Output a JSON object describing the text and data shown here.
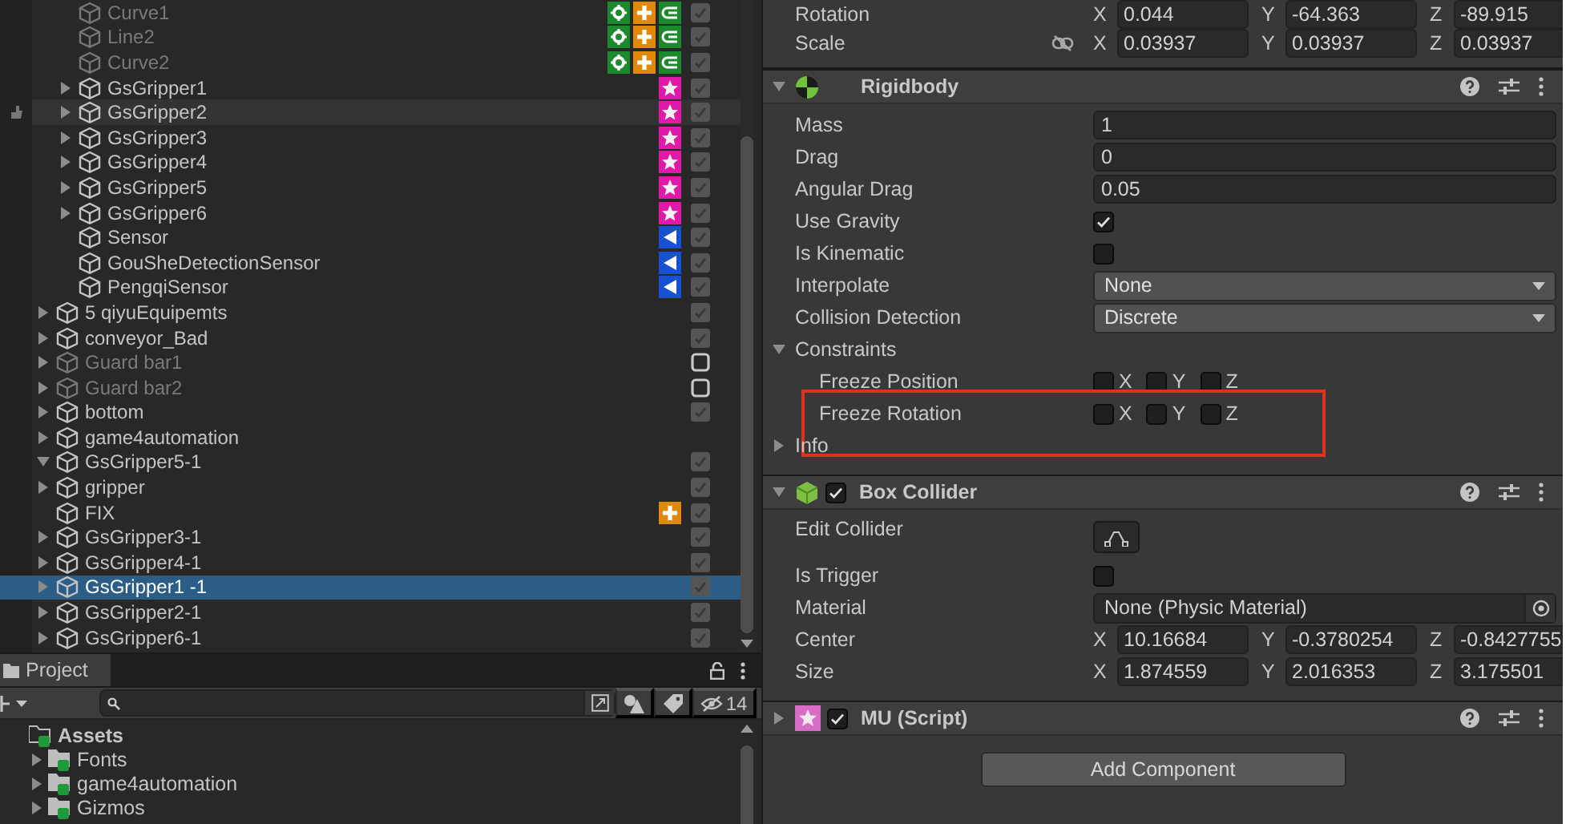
{
  "hierarchy": {
    "items": [
      {
        "children": [
          {
            "children": [
              {
                "children": [
                  {
                    "label": "Curve1",
                    "dimmed": true,
                    "selected": false,
                    "hovered": false,
                    "checked": true,
                    "badges": [
                      {
                        "kind": "gear"
                      },
                      {
                        "kind": "plus"
                      },
                      {
                        "kind": "curve"
                      }
                    ]
                  },
                  {
                    "label": "Line2",
                    "dimmed": true,
                    "selected": false,
                    "hovered": false,
                    "checked": true,
                    "badges": [
                      {
                        "kind": "gear"
                      },
                      {
                        "kind": "plus"
                      },
                      {
                        "kind": "curve"
                      }
                    ]
                  },
                  {
                    "label": "Curve2",
                    "dimmed": true,
                    "selected": false,
                    "hovered": false,
                    "checked": true,
                    "badges": [
                      {
                        "kind": "gear"
                      },
                      {
                        "kind": "plus"
                      },
                      {
                        "kind": "curve"
                      }
                    ]
                  },
                  {
                    "label": "GsGripper1",
                    "expanded": false,
                    "dimmed": false,
                    "selected": false,
                    "hovered": false,
                    "checked": true,
                    "badges": [
                      {
                        "kind": "star"
                      }
                    ]
                  },
                  {
                    "label": "GsGripper2",
                    "expanded": false,
                    "dimmed": false,
                    "selected": false,
                    "hovered": true,
                    "checked": true,
                    "badges": [
                      {
                        "kind": "star"
                      }
                    ]
                  },
                  {
                    "label": "GsGripper3",
                    "expanded": false,
                    "dimmed": false,
                    "selected": false,
                    "hovered": false,
                    "checked": true,
                    "badges": [
                      {
                        "kind": "star"
                      }
                    ]
                  },
                  {
                    "label": "GsGripper4",
                    "expanded": false,
                    "dimmed": false,
                    "selected": false,
                    "hovered": false,
                    "checked": true,
                    "badges": [
                      {
                        "kind": "star"
                      }
                    ]
                  },
                  {
                    "label": "GsGripper5",
                    "expanded": false,
                    "dimmed": false,
                    "selected": false,
                    "hovered": false,
                    "checked": true,
                    "badges": [
                      {
                        "kind": "star"
                      }
                    ]
                  },
                  {
                    "label": "GsGripper6",
                    "expanded": false,
                    "dimmed": false,
                    "selected": false,
                    "hovered": false,
                    "checked": true,
                    "badges": [
                      {
                        "kind": "star"
                      }
                    ]
                  },
                  {
                    "label": "Sensor",
                    "dimmed": false,
                    "selected": false,
                    "hovered": false,
                    "checked": true,
                    "badges": [
                      {
                        "kind": "sensor"
                      }
                    ]
                  },
                  {
                    "label": "GouSheDetectionSensor",
                    "dimmed": false,
                    "selected": false,
                    "hovered": false,
                    "checked": true,
                    "badges": [
                      {
                        "kind": "sensor"
                      }
                    ]
                  },
                  {
                    "label": "PengqiSensor",
                    "dimmed": false,
                    "selected": false,
                    "hovered": false,
                    "checked": true,
                    "badges": [
                      {
                        "kind": "sensor"
                      }
                    ]
                  }
                ]
              }
            ]
          },
          {
            "label": "5 qiyuEquipemts",
            "expanded": false,
            "dimmed": false,
            "selected": false,
            "hovered": false,
            "checked": true
          },
          {
            "label": "conveyor_Bad",
            "expanded": false,
            "dimmed": false,
            "selected": false,
            "hovered": false,
            "checked": true
          },
          {
            "label": "Guard bar1",
            "expanded": false,
            "dimmed": true,
            "selected": false,
            "hovered": false,
            "checked": false
          },
          {
            "label": "Guard bar2",
            "expanded": false,
            "dimmed": true,
            "selected": false,
            "hovered": false,
            "checked": false
          },
          {
            "label": "bottom",
            "expanded": false,
            "dimmed": false,
            "selected": false,
            "hovered": false,
            "checked": true
          }
        ]
      },
      {
        "label": "game4automation",
        "expanded": false,
        "dimmed": false,
        "selected": false,
        "hovered": false
      },
      {
        "label": "GsGripper5-1",
        "expanded": true,
        "dimmed": false,
        "selected": false,
        "hovered": false,
        "checked": true,
        "children": [
          {
            "label": "gripper",
            "expanded": false,
            "dimmed": false,
            "selected": false,
            "hovered": false,
            "checked": true
          },
          {
            "label": "FIX",
            "dimmed": false,
            "selected": false,
            "hovered": false,
            "checked": true,
            "badges": [
              {
                "kind": "plus"
              }
            ]
          }
        ]
      },
      {
        "label": "GsGripper3-1",
        "expanded": false,
        "dimmed": false,
        "selected": false,
        "hovered": false,
        "checked": true
      },
      {
        "label": "GsGripper4-1",
        "expanded": false,
        "dimmed": false,
        "selected": false,
        "hovered": false,
        "checked": true
      },
      {
        "label": "GsGripper1 -1",
        "expanded": false,
        "dimmed": false,
        "selected": true,
        "hovered": false,
        "checked": true
      },
      {
        "label": "GsGripper2-1",
        "expanded": false,
        "dimmed": false,
        "selected": false,
        "hovered": false,
        "checked": true
      },
      {
        "label": "GsGripper6-1",
        "expanded": false,
        "dimmed": false,
        "selected": false,
        "hovered": false,
        "checked": true
      }
    ]
  },
  "project": {
    "tab": "Project",
    "hidden_count": "14",
    "items": [
      {
        "label": "Assets",
        "expanded": true,
        "children": [
          {
            "label": "Fonts",
            "expanded": false
          },
          {
            "label": "game4automation",
            "expanded": false
          },
          {
            "label": "Gizmos",
            "expanded": false
          }
        ]
      }
    ]
  },
  "inspector": {
    "transform": [
      {
        "label": "Rotation",
        "axes": [
          {
            "axis": "X",
            "value": "0.044"
          },
          {
            "axis": "Y",
            "value": "-64.363"
          },
          {
            "axis": "Z",
            "value": "-89.915"
          }
        ]
      },
      {
        "label": "Scale",
        "constrain_proportions": false,
        "axes": [
          {
            "axis": "X",
            "value": "0.03937"
          },
          {
            "axis": "Y",
            "value": "0.03937"
          },
          {
            "axis": "Z",
            "value": "0.03937"
          }
        ]
      }
    ],
    "components": [
      {
        "title": "Rigidbody",
        "kind": "rigidbody",
        "expanded": true,
        "fields": [
          {
            "kind": "text",
            "label": "Mass",
            "value": "1"
          },
          {
            "kind": "text",
            "label": "Drag",
            "value": "0"
          },
          {
            "kind": "text",
            "label": "Angular Drag",
            "value": "0.05"
          },
          {
            "kind": "checkbox",
            "label": "Use Gravity",
            "checked": true
          },
          {
            "kind": "checkbox",
            "label": "Is Kinematic",
            "checked": false
          },
          {
            "kind": "dropdown",
            "label": "Interpolate",
            "value": "None"
          },
          {
            "kind": "dropdown",
            "label": "Collision Detection",
            "value": "Discrete"
          },
          {
            "kind": "foldout",
            "label": "Constraints",
            "expanded": true,
            "children": [
              {
                "kind": "axis_checks",
                "label": "Freeze Position",
                "highlighted": false,
                "axes": [
                  {
                    "axis": "X",
                    "checked": false
                  },
                  {
                    "axis": "Y",
                    "checked": false
                  },
                  {
                    "axis": "Z",
                    "checked": false
                  }
                ]
              },
              {
                "kind": "axis_checks",
                "label": "Freeze Rotation",
                "highlighted": true,
                "axes": [
                  {
                    "axis": "X",
                    "checked": false
                  },
                  {
                    "axis": "Y",
                    "checked": false
                  },
                  {
                    "axis": "Z",
                    "checked": false
                  }
                ]
              }
            ]
          },
          {
            "kind": "foldout",
            "label": "Info",
            "expanded": false
          }
        ]
      },
      {
        "title": "Box Collider",
        "kind": "box_collider",
        "enabled": true,
        "expanded": true,
        "fields": [
          {
            "kind": "edit_button",
            "label": "Edit Collider"
          },
          {
            "kind": "checkbox",
            "label": "Is Trigger",
            "checked": false
          },
          {
            "kind": "object",
            "label": "Material",
            "value": "None (Physic Material)"
          },
          {
            "kind": "vector",
            "label": "Center",
            "axes": [
              {
                "axis": "X",
                "value": "10.16684"
              },
              {
                "axis": "Y",
                "value": "-0.3780254"
              },
              {
                "axis": "Z",
                "value": "-0.8427755"
              }
            ]
          },
          {
            "kind": "vector",
            "label": "Size",
            "axes": [
              {
                "axis": "X",
                "value": "1.874559"
              },
              {
                "axis": "Y",
                "value": "2.016353"
              },
              {
                "axis": "Z",
                "value": "3.175501"
              }
            ]
          }
        ]
      },
      {
        "title": "MU (Script)",
        "kind": "script",
        "enabled": true,
        "expanded": false
      }
    ],
    "add_component": "Add Component"
  }
}
